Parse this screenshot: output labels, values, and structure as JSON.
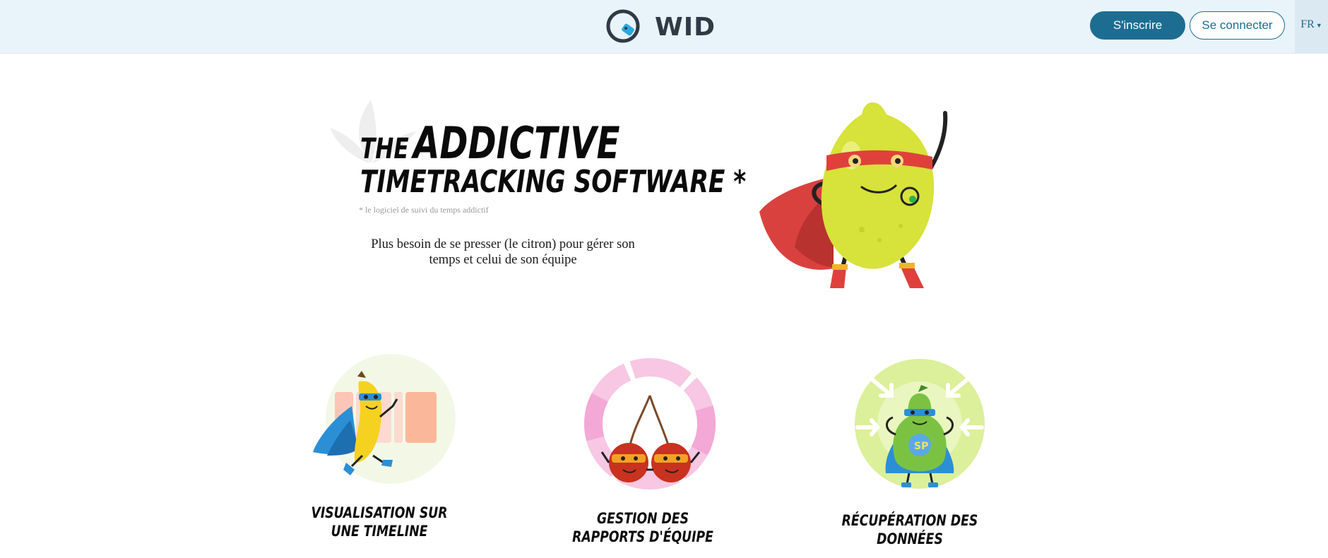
{
  "header": {
    "brand": "WID",
    "signup_label": "S'inscrire",
    "login_label": "Se connecter",
    "language": "FR",
    "colors": {
      "header_bg": "#e8f4fa",
      "primary": "#1d6d92"
    }
  },
  "hero": {
    "title_the": "THE",
    "title_addictive": "ADDICTIVE",
    "title_line2": "TIMETRACKING SOFTWARE *",
    "footnote": "* le logiciel de suivi du temps addictif",
    "description": "Plus besoin de se presser (le citron) pour gérer son temps et celui de son équipe",
    "illustration": "lemon-superhero"
  },
  "features": [
    {
      "title": "VISUALISATION SUR UNE TIMELINE",
      "illustration": "banana-superhero-timeline"
    },
    {
      "title": "GESTION DES RAPPORTS D'ÉQUIPE",
      "illustration": "cherries-superheroes-donut"
    },
    {
      "title": "RÉCUPÉRATION DES DONNÉES",
      "illustration": "pear-superhero-arrows"
    }
  ]
}
